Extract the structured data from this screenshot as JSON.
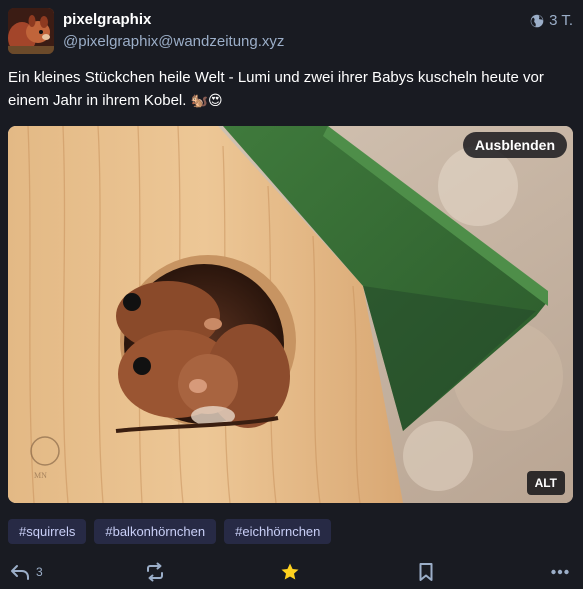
{
  "account": {
    "display_name": "pixelgraphix",
    "handle": "@pixelgraphix@wandzeitung.xyz",
    "avatar_icon": "squirrel-avatar"
  },
  "status": {
    "time": "3 T.",
    "visibility_icon": "globe-icon",
    "text": "Ein kleines Stückchen heile Welt - Lumi und zwei ihrer Babys kuscheln heute vor einem Jahr in ihrem Kobel.",
    "emoji": "🐿️😍"
  },
  "media": {
    "hide_label": "Ausblenden",
    "alt_label": "ALT",
    "watermark_icon": "photographer-watermark"
  },
  "hashtags": [
    "#squirrels",
    "#balkonhörnchen",
    "#eichhörnchen"
  ],
  "actions": {
    "reply_count": "3",
    "favourite_color": "#ffd21f",
    "muted_color": "#9baec8"
  }
}
